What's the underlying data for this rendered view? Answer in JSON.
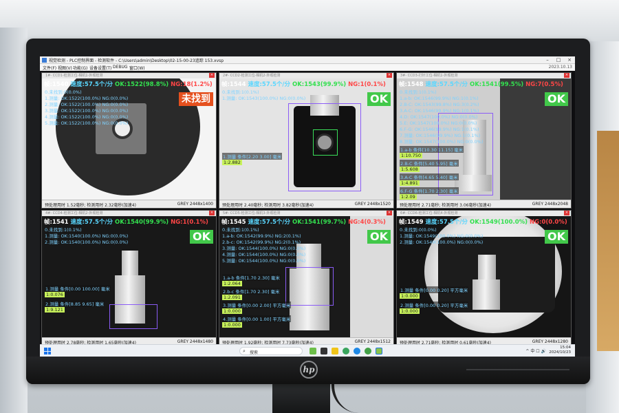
{
  "window": {
    "title": "视觉检测 - PLC控制界面 - 检测软件 - C:\\Users\\admin\\Desktop\\02-15-00-23追踪 153.xvsp",
    "controls": [
      "–",
      "□",
      "×"
    ],
    "menu": [
      "文件(F)",
      "视图(V)",
      "功能(G)",
      "设备设置(T)",
      "DEBUG",
      "窗口(W)"
    ],
    "version": "2023.10.13"
  },
  "panels": [
    {
      "header": "1#- CCD1-检测工位-相机1-外观检测",
      "frame": "帧:1540",
      "speed": "速度:57.5个/分",
      "ok": "OK:1522(98.8%)",
      "ng": "NG:18(1.2%)",
      "badge": "未找到",
      "badge_state": "ng",
      "lines": [
        {
          "t": "0.未找到:0(0.0%)",
          "c": "c"
        },
        {
          "t": "1.测量: OK:1522(100.0%)   NG:0(0.0%)",
          "c": "c"
        },
        {
          "t": "2.测量: OK:1522(100.0%)   NG:0(0.0%)",
          "c": "c"
        },
        {
          "t": "3.测量: OK:1522(100.0%)   NG:0(0.0%)",
          "c": "c"
        },
        {
          "t": "4.测量: OK:1522(100.0%)   NG:0(0.0%)",
          "c": "c"
        },
        {
          "t": "5.测量: OK:1522(100.0%)   NG:0(0.0%)",
          "c": "c"
        }
      ],
      "measures": [],
      "status_left": "预处理用时 1.52毫秒; 检测用时 2.32毫秒(加速4)",
      "status_right": "GREY 2448x1400"
    },
    {
      "header": "2#- CCD2-检测工位-相机2-外观检测",
      "frame": "帧:1544",
      "speed": "速度:57.5个/分",
      "ok": "OK:1543(99.9%)",
      "ng": "NG:1(0.1%)",
      "badge": "OK",
      "badge_state": "ok",
      "lines": [
        {
          "t": "0.未找到:1(0.1%)",
          "c": "c"
        },
        {
          "t": "1.测量: OK:1543(100.0%)   NG:0(0.0%)",
          "c": "c"
        }
      ],
      "measures": [
        {
          "label": "1.测量 条件[2.20 3.00] 毫米",
          "value": "1:2.882"
        }
      ],
      "status_left": "预处理用时 2.40毫秒; 检测用时 3.82毫秒(加速4)",
      "status_right": "GREY 2448x1520"
    },
    {
      "header": "3#- CCD3-打针工位-相机1-外观检测",
      "frame": "帧:1548",
      "speed": "速度:57.5个/分",
      "ok": "OK:1541(99.5%)",
      "ng": "NG:7(0.5%)",
      "badge": "OK",
      "badge_state": "ok",
      "lines": [
        {
          "t": "0.未找到:1(0.1%)",
          "c": "c"
        },
        {
          "t": "1.a-b: OK:1546(99.9%)   NG:1(0.1%)",
          "c": "c"
        },
        {
          "t": "2.B-C: OK:1543(99.8%)   NG:3(0.2%)",
          "c": "c"
        },
        {
          "t": "3.A-C: OK:1546(99.9%)   NG:1(0.1%)",
          "c": "c"
        },
        {
          "t": "4.D: OK:1547(100.0%)   NG:0(0.0%)",
          "c": "c"
        },
        {
          "t": "5.E: OK:1547(100.0%)   NG:0(0.0%)",
          "c": "c"
        },
        {
          "t": "6.F-G: OK:1546(99.9%)   NG:1(0.1%)",
          "c": "c"
        },
        {
          "t": "7.测量: OK:1546(99.9%)   NG:1(0.1%)",
          "c": "c"
        },
        {
          "t": "8.测量: OK:1547(100.0%)   NG:0(0.0%)",
          "c": "c"
        }
      ],
      "measures": [
        {
          "label": "1.a-b 条件[10.30 11.15] 毫米",
          "value": "1:10.750"
        },
        {
          "label": "2.B-C 条件[5.40 5.95] 毫米",
          "value": "1:5.608"
        },
        {
          "label": "3.A-C 条件[4.65 5.40] 毫米",
          "value": "1:4.891"
        },
        {
          "label": "6.F-G 条件[1.70 2.30] 毫米",
          "value": "1:2.09"
        }
      ],
      "status_left": "预处理用时 2.71毫秒; 检测用时 3.06毫秒(加速4)",
      "status_right": "GREY 2448x2048"
    },
    {
      "header": "4#- CCD4-检测工位-相机2-外观检测",
      "frame": "帧:1541",
      "speed": "速度:57.5个/分",
      "ok": "OK:1540(99.9%)",
      "ng": "NG:1(0.1%)",
      "badge": "OK",
      "badge_state": "ok",
      "lines": [
        {
          "t": "0.未找到:1(0.1%)",
          "c": "c"
        },
        {
          "t": "1.测量: OK:1540(100.0%)   NG:0(0.0%)",
          "c": "c"
        },
        {
          "t": "2.测量: OK:1540(100.0%)   NG:0(0.0%)",
          "c": "c"
        }
      ],
      "measures": [
        {
          "label": "1.测量 条件[0.00 100.00] 毫米",
          "value": "1:0.076"
        },
        {
          "label": "2.测量 条件[8.85 9.65] 毫米",
          "value": "1:9.121"
        }
      ],
      "status_left": "预处理用时 2.78毫秒; 检测用时 1.65毫秒(加速4)",
      "status_right": "GREY 2448x1480"
    },
    {
      "header": "5#- CCD5-检测工位-相机3-外观检测",
      "frame": "帧:1545",
      "speed": "速度:57.5个/分",
      "ok": "OK:1541(99.7%)",
      "ng": "NG:4(0.3%)",
      "badge": "OK",
      "badge_state": "ok",
      "lines": [
        {
          "t": "0.未找到:1(0.1%)",
          "c": "c"
        },
        {
          "t": "1.a-b: OK:1542(99.9%)   NG:2(0.1%)",
          "c": "c"
        },
        {
          "t": "2.b-c: OK:1542(99.9%)   NG:2(0.1%)",
          "c": "c"
        },
        {
          "t": "3.测量: OK:1544(100.0%)   NG:0(0.0%)",
          "c": "c"
        },
        {
          "t": "4.测量: OK:1544(100.0%)   NG:0(0.0%)",
          "c": "c"
        },
        {
          "t": "5.测量: OK:1544(100.0%)   NG:0(0.0%)",
          "c": "c"
        }
      ],
      "measures": [
        {
          "label": "1.a-b 条件[1.70 2.30] 毫米",
          "value": "1:2.064"
        },
        {
          "label": "2.b-c 条件[1.70 2.30] 毫米",
          "value": "1:2.091"
        },
        {
          "label": "3.测量 条件[0.00 2.00] 平方毫米",
          "value": "1:0.000"
        },
        {
          "label": "4.测量 条件[0.00 1.00] 平方毫米",
          "value": "1:0.000"
        }
      ],
      "status_left": "预处理用时 1.92毫秒; 检测用时 7.73毫秒(加速4)",
      "status_right": "GREY 2448x1512"
    },
    {
      "header": "6#- CCD6-检测工位-相机4-外观检测",
      "frame": "帧:1549",
      "speed": "速度:57.5个/分",
      "ok": "OK:1549(100.0%)",
      "ng": "NG:0(0.0%)",
      "badge": "OK",
      "badge_state": "ok",
      "lines": [
        {
          "t": "0.未找到:0(0.0%)",
          "c": "c"
        },
        {
          "t": "1.测量: OK:1549(100.0%)   NG:0(0.0%)",
          "c": "c"
        },
        {
          "t": "2.测量: OK:1549(100.0%)   NG:0(0.0%)",
          "c": "c"
        }
      ],
      "measures": [
        {
          "label": "1.测量 条件[0.00 0.20] 平方毫米",
          "value": "1:0.000"
        },
        {
          "label": "2.测量 条件[0.00 0.20] 平方毫米",
          "value": "1:0.000"
        }
      ],
      "status_left": "预处理用时 2.71毫秒; 检测用时 0.61毫秒(加速4)",
      "status_right": "GREY 2448x1280"
    }
  ],
  "taskbar": {
    "search_placeholder": "搜索",
    "tray": "^  中  ☐  🔊",
    "time": "15:04",
    "date": "2024/10/23"
  },
  "monitor_brand": "hp"
}
